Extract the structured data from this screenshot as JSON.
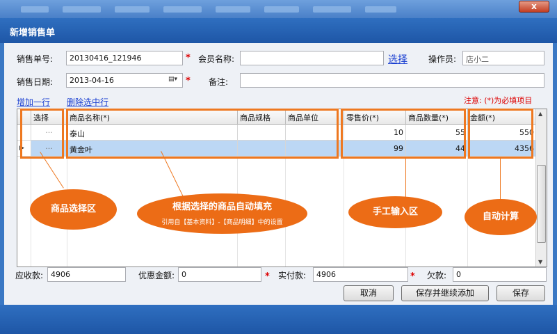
{
  "window": {
    "close_label": "x"
  },
  "title": "新增销售单",
  "form": {
    "order_no_label": "销售单号:",
    "order_no": "20130416_121946",
    "member_label": "会员名称:",
    "member_value": "",
    "select_link": "选择",
    "operator_label": "操作员:",
    "operator_value": "店小二",
    "date_label": "销售日期:",
    "date_value": "2013-04-16",
    "remark_label": "备注:",
    "remark_value": "",
    "required_mark": "*"
  },
  "actions": {
    "add_row": "增加一行",
    "delete_row": "删除选中行"
  },
  "required_note": "注意: (*)为必填项目",
  "grid": {
    "columns": [
      "选择",
      "商品名称(*)",
      "商品规格",
      "商品单位",
      "零售价(*)",
      "商品数量(*)",
      "金额(*)"
    ],
    "rows": [
      {
        "select": "···",
        "name": "泰山",
        "spec": "",
        "unit": "",
        "price": "10",
        "qty": "55",
        "amount": "550"
      },
      {
        "select": "···",
        "name": "黄金叶",
        "spec": "",
        "unit": "",
        "price": "99",
        "qty": "44",
        "amount": "4356"
      }
    ]
  },
  "annotations": {
    "product_select": "商品选择区",
    "auto_fill_title": "根据选择的商品自动填充",
    "auto_fill_sub": "引用自【基本资料】-【商品明细】中的设置",
    "manual_input": "手工输入区",
    "auto_calc": "自动计算"
  },
  "totals": {
    "receivable_label": "应收款:",
    "receivable": "4906",
    "discount_label": "优惠金额:",
    "discount": "0",
    "paid_label": "实付款:",
    "paid": "4906",
    "owed_label": "欠款:",
    "owed": "0"
  },
  "buttons": {
    "cancel": "取消",
    "save_continue": "保存并继续添加",
    "save": "保存"
  },
  "colors": {
    "highlight": "#ee7820",
    "bubble": "#ec6c16",
    "title_bar": "#1e56a6",
    "selected_row": "#bcd7f4",
    "required": "#dd0000",
    "link": "#1a3fd1"
  }
}
